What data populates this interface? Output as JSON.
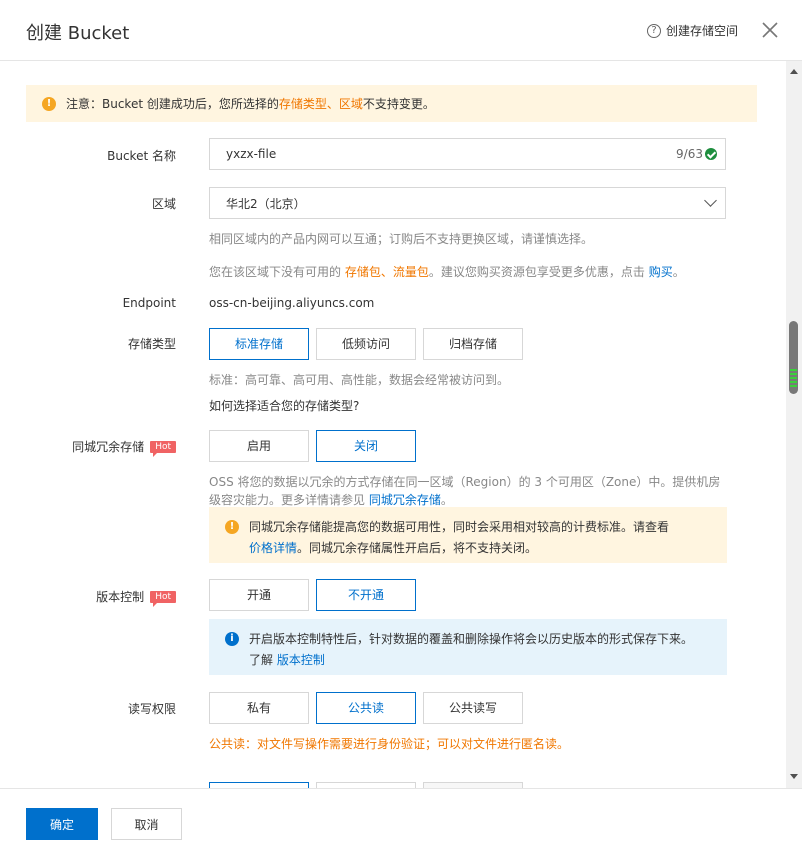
{
  "header": {
    "title": "创建 Bucket",
    "help_label": "创建存储空间"
  },
  "notice": {
    "prefix": "注意：Bucket 创建成功后，您所选择的 ",
    "hl1": "存储类型",
    "sep": "、",
    "hl2": "区域",
    "suffix": " 不支持变更。"
  },
  "bucket_name": {
    "label": "Bucket 名称",
    "value": "yxzx-file",
    "counter": "9/63"
  },
  "region": {
    "label": "区域",
    "value": "华北2（北京）",
    "hint1": "相同区域内的产品内网可以互通；订购后不支持更换区域，请谨慎选择。",
    "hint2_prefix": "您在该区域下没有可用的 ",
    "hint2_hl1": "存储包",
    "hint2_sep": "、",
    "hint2_hl2": "流量包",
    "hint2_mid": "。建议您购买资源包享受更多优惠，点击 ",
    "hint2_link": "购买",
    "hint2_suffix": "。"
  },
  "endpoint": {
    "label": "Endpoint",
    "value": "oss-cn-beijing.aliyuncs.com"
  },
  "storage_class": {
    "label": "存储类型",
    "options": [
      "标准存储",
      "低频访问",
      "归档存储"
    ],
    "hint": "标准：高可靠、高可用、高性能，数据会经常被访问到。",
    "link": "如何选择适合您的存储类型?"
  },
  "zrs": {
    "label": "同城冗余存储",
    "hot": "Hot",
    "options": [
      "启用",
      "关闭"
    ],
    "desc_line1": "OSS 将您的数据以冗余的方式存储在同一区域（Region）的 3 个可用区（Zone）中。提供机房",
    "desc_line2_prefix": "级容灾能力。更多详情请参见 ",
    "desc_link": "同城冗余存储",
    "desc_line2_suffix": "。",
    "warn_line1": "同城冗余存储能提高您的数据可用性，同时会采用相对较高的计费标准。请查看",
    "warn_link": "价格详情",
    "warn_line2": "。同城冗余存储属性开启后，将不支持关闭。"
  },
  "versioning": {
    "label": "版本控制",
    "hot": "Hot",
    "options": [
      "开通",
      "不开通"
    ],
    "info_line1": "开启版本控制特性后，针对数据的覆盖和删除操作将会以历史版本的形式保存下来。",
    "info_line2_prefix": "了解 ",
    "info_link": "版本控制"
  },
  "acl": {
    "label": "读写权限",
    "options": [
      "私有",
      "公共读",
      "公共读写"
    ],
    "note": "公共读：对文件写操作需要进行身份验证；可以对文件进行匿名读。"
  },
  "footer": {
    "confirm": "确定",
    "cancel": "取消"
  },
  "colors": {
    "primary": "#0070cc",
    "warning": "#f07700",
    "hot": "#f06364"
  }
}
